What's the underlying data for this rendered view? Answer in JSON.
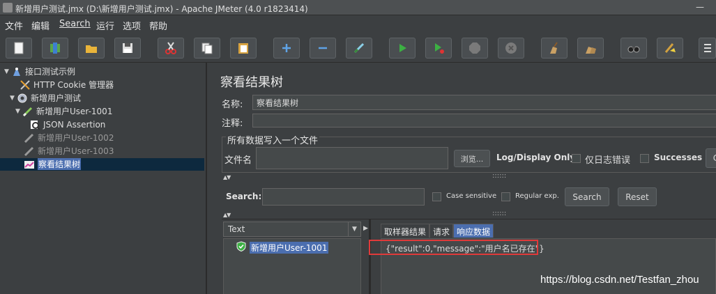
{
  "window": {
    "title": "新增用户测试.jmx (D:\\新增用户测试.jmx) - Apache JMeter (4.0 r1823414)",
    "min_glyph": "—"
  },
  "menu": [
    "文件",
    "编辑",
    "Search",
    "运行",
    "选项",
    "帮助"
  ],
  "toolbar": {
    "icons": [
      "new-icon",
      "templates-icon",
      "open-icon",
      "save-icon",
      "cut-icon",
      "copy-icon",
      "paste-icon",
      "expand-icon",
      "collapse-icon",
      "toggle-icon",
      "start-icon",
      "start-no-pause-icon",
      "stop-icon",
      "shutdown-icon",
      "clear-icon",
      "clear-all-icon",
      "search-icon",
      "reset-search-icon",
      "function-helper-icon"
    ]
  },
  "tree": {
    "items": [
      {
        "label": "接口测试示例",
        "icon": "test-plan-icon",
        "disabled": false
      },
      {
        "label": "HTTP Cookie 管理器",
        "icon": "config-element-icon",
        "disabled": false
      },
      {
        "label": "新增用户测试",
        "icon": "thread-group-icon",
        "disabled": false
      },
      {
        "label": "新增用户User-1001",
        "icon": "sampler-icon",
        "disabled": false
      },
      {
        "label": "JSON Assertion",
        "icon": "assertion-icon",
        "disabled": false
      },
      {
        "label": "新增用户User-1002",
        "icon": "sampler-icon",
        "disabled": true
      },
      {
        "label": "新增用户User-1003",
        "icon": "sampler-icon",
        "disabled": true
      },
      {
        "label": "察看结果树",
        "icon": "listener-icon",
        "disabled": false
      }
    ]
  },
  "panel": {
    "title": "察看结果树",
    "name_label": "名称:",
    "name_value": "察看结果树",
    "comment_label": "注释:",
    "comment_value": "",
    "file_group_label": "所有数据写入一个文件",
    "filename_label": "文件名",
    "filename_value": "",
    "browse_label": "浏览...",
    "log_display_label": "Log/Display Only:",
    "errors_label": "仅日志错误",
    "successes_label": "Successes",
    "configure_label": "C",
    "search_label": "Search:",
    "search_value": "",
    "case_sensitive_label": "Case sensitive",
    "regex_label": "Regular exp.",
    "search_button": "Search",
    "reset_button": "Reset",
    "dots": "::::::"
  },
  "results": {
    "renderer": "Text",
    "items": [
      {
        "label": "新增用户User-1001",
        "status": "success"
      }
    ],
    "tabs": [
      "取样器结果",
      "请求",
      "响应数据"
    ],
    "active_tab": 2,
    "response_body": "{\"result\":0,\"message\":\"用户名已存在\"}"
  },
  "watermark": "https://blog.csdn.net/Testfan_zhou",
  "colors": {
    "selection": "#4b6eaf",
    "highlight_border": "#e03a3a",
    "success": "#3cb043"
  }
}
